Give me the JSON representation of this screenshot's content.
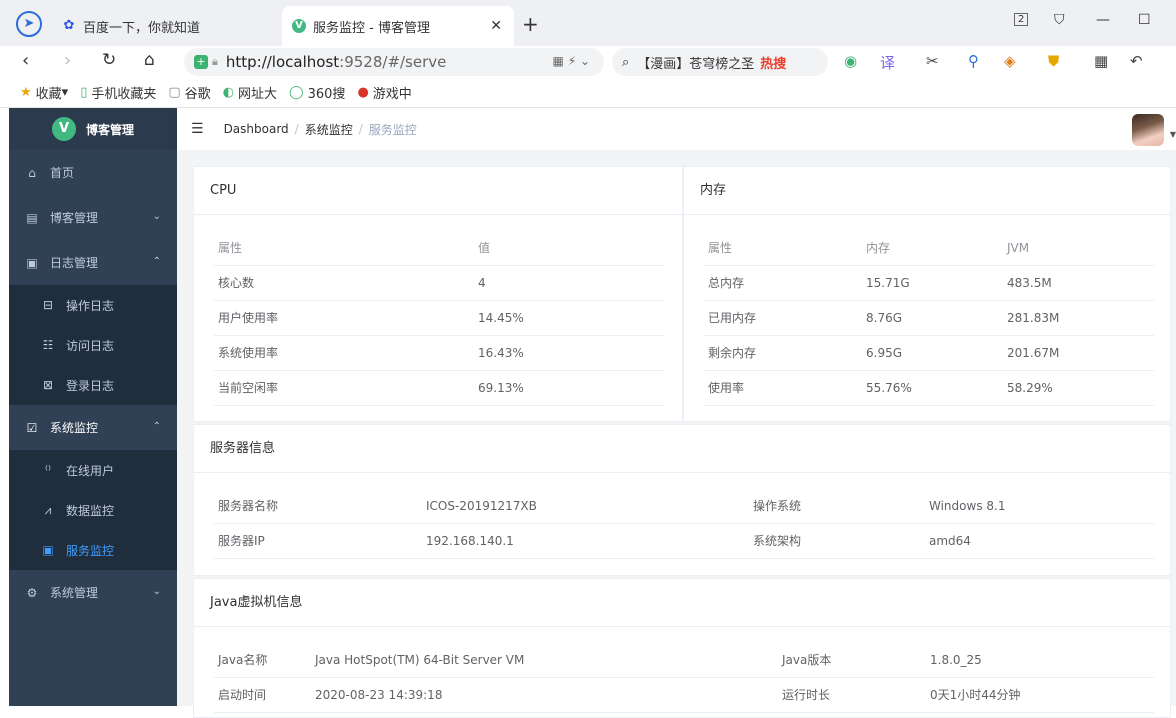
{
  "browser": {
    "tabs": [
      {
        "title": "百度一下，你就知道",
        "icon": "baidu-paw-icon"
      },
      {
        "title": "服务监控 - 博客管理",
        "icon": "vue-logo-icon"
      }
    ],
    "tab_count": "2",
    "url_host": "http://localhost",
    "url_path": ":9528/#/serve",
    "search_text": "【漫画】苍穹榜之圣",
    "search_hot": "热搜",
    "bookmarks": [
      {
        "label": "收藏",
        "icon": "star-icon"
      },
      {
        "label": "手机收藏夹",
        "icon": "phone-icon"
      },
      {
        "label": "谷歌",
        "icon": "page-icon"
      },
      {
        "label": "网址大",
        "icon": "compass-icon"
      },
      {
        "label": "360搜",
        "icon": "360-search-icon"
      },
      {
        "label": "游戏中",
        "icon": "game-icon"
      }
    ]
  },
  "app": {
    "name": "博客管理",
    "logo_letter": "V"
  },
  "sidebar": {
    "items": [
      {
        "label": "首页",
        "icon": "home-icon"
      },
      {
        "label": "博客管理",
        "icon": "blog-icon"
      },
      {
        "label": "日志管理",
        "icon": "log-icon"
      },
      {
        "label": "操作日志",
        "icon": "operation-log-icon"
      },
      {
        "label": "访问日志",
        "icon": "visit-log-icon"
      },
      {
        "label": "登录日志",
        "icon": "login-log-icon"
      },
      {
        "label": "系统监控",
        "icon": "monitor-icon"
      },
      {
        "label": "在线用户",
        "icon": "online-users-icon"
      },
      {
        "label": "数据监控",
        "icon": "data-monitor-icon"
      },
      {
        "label": "服务监控",
        "icon": "server-monitor-icon"
      },
      {
        "label": "系统管理",
        "icon": "settings-icon"
      }
    ]
  },
  "breadcrumb": [
    "Dashboard",
    "系统监控",
    "服务监控"
  ],
  "cpu": {
    "title": "CPU",
    "headers": [
      "属性",
      "值"
    ],
    "rows": [
      [
        "核心数",
        "4"
      ],
      [
        "用户使用率",
        "14.45%"
      ],
      [
        "系统使用率",
        "16.43%"
      ],
      [
        "当前空闲率",
        "69.13%"
      ]
    ]
  },
  "memory": {
    "title": "内存",
    "headers": [
      "属性",
      "内存",
      "JVM"
    ],
    "rows": [
      [
        "总内存",
        "15.71G",
        "483.5M"
      ],
      [
        "已用内存",
        "8.76G",
        "281.83M"
      ],
      [
        "剩余内存",
        "6.95G",
        "201.67M"
      ],
      [
        "使用率",
        "55.76%",
        "58.29%"
      ]
    ]
  },
  "server": {
    "title": "服务器信息",
    "rows": [
      [
        "服务器名称",
        "ICOS-20191217XB",
        "操作系统",
        "Windows 8.1"
      ],
      [
        "服务器IP",
        "192.168.140.1",
        "系统架构",
        "amd64"
      ]
    ]
  },
  "jvm": {
    "title": "Java虚拟机信息",
    "rows": [
      [
        "Java名称",
        "Java HotSpot(TM) 64-Bit Server VM",
        "Java版本",
        "1.8.0_25"
      ],
      [
        "启动时间",
        "2020-08-23 14:39:18",
        "运行时长",
        "0天1小时44分钟"
      ]
    ]
  },
  "colors": {
    "sidebar_bg": "#304156",
    "submenu_bg": "#1f2d3d",
    "active": "#409eff",
    "brand_green": "#42b883"
  }
}
